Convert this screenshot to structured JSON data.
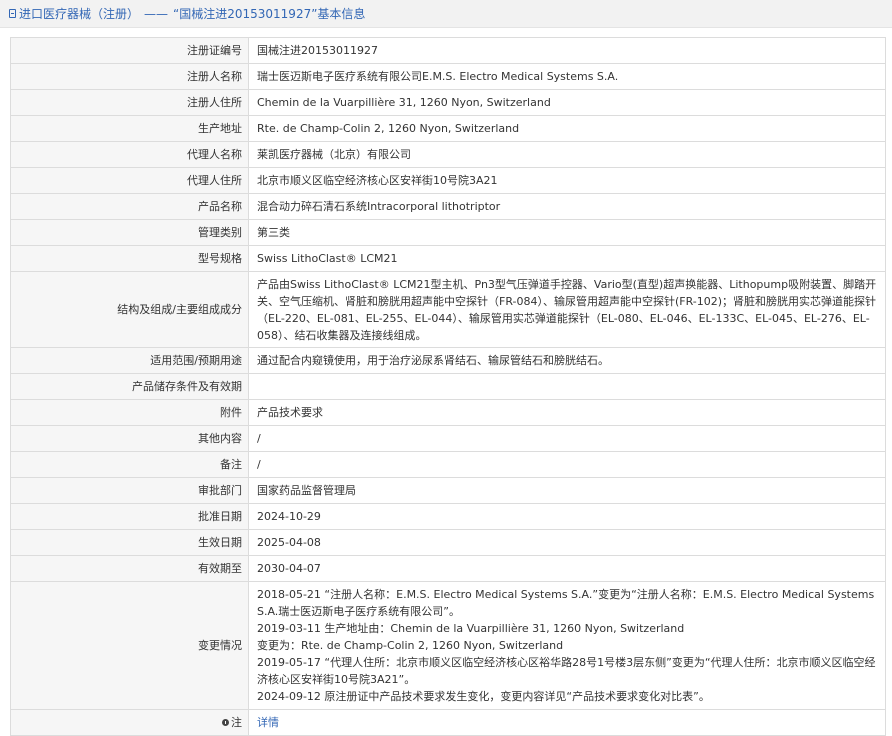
{
  "header": {
    "section": "进口医疗器械（注册）",
    "separator": "——",
    "record_title": "“国械注进20153011927”基本信息"
  },
  "rows": [
    {
      "label": "注册证编号",
      "value": "国械注进20153011927"
    },
    {
      "label": "注册人名称",
      "value": "瑞士医迈斯电子医疗系统有限公司E.M.S. Electro Medical Systems S.A."
    },
    {
      "label": "注册人住所",
      "value": "Chemin de la Vuarpillière 31, 1260 Nyon, Switzerland"
    },
    {
      "label": "生产地址",
      "value": "Rte. de Champ-Colin 2, 1260 Nyon, Switzerland"
    },
    {
      "label": "代理人名称",
      "value": "莱凯医疗器械（北京）有限公司"
    },
    {
      "label": "代理人住所",
      "value": "北京市顺义区临空经济核心区安祥街10号院3A21"
    },
    {
      "label": "产品名称",
      "value": "混合动力碎石清石系统Intracorporal lithotriptor"
    },
    {
      "label": "管理类别",
      "value": "第三类"
    },
    {
      "label": "型号规格",
      "value": "Swiss LithoClast® LCM21"
    },
    {
      "label": "结构及组成/主要组成成分",
      "value": "产品由Swiss LithoClast® LCM21型主机、Pn3型气压弹道手控器、Vario型(直型)超声换能器、Lithopump吸附装置、脚踏开关、空气压缩机、肾脏和膀胱用超声能中空探针（FR-084）、输尿管用超声能中空探针(FR-102)；肾脏和膀胱用实芯弹道能探针（EL-220、EL-081、EL-255、EL-044）、输尿管用实芯弹道能探针（EL-080、EL-046、EL-133C、EL-045、EL-276、EL-058）、结石收集器及连接线组成。"
    },
    {
      "label": "适用范围/预期用途",
      "value": "通过配合内窥镜使用，用于治疗泌尿系肾结石、输尿管结石和膀胱结石。"
    },
    {
      "label": "产品储存条件及有效期",
      "value": ""
    },
    {
      "label": "附件",
      "value": "产品技术要求"
    },
    {
      "label": "其他内容",
      "value": "/"
    },
    {
      "label": "备注",
      "value": "/"
    },
    {
      "label": "审批部门",
      "value": "国家药品监督管理局"
    },
    {
      "label": "批准日期",
      "value": "2024-10-29"
    },
    {
      "label": "生效日期",
      "value": "2025-04-08"
    },
    {
      "label": "有效期至",
      "value": "2030-04-07"
    }
  ],
  "changes": {
    "label": "变更情况",
    "lines": [
      "2018-05-21 “注册人名称：E.M.S. Electro Medical Systems S.A.”变更为“注册人名称：E.M.S. Electro Medical Systems S.A.瑞士医迈斯电子医疗系统有限公司”。",
      "2019-03-11 生产地址由：Chemin de la Vuarpillière 31, 1260 Nyon, Switzerland",
      "变更为：Rte. de Champ-Colin 2, 1260 Nyon, Switzerland",
      "2019-05-17 “代理人住所：北京市顺义区临空经济核心区裕华路28号1号楼3层东侧”变更为“代理人住所：北京市顺义区临空经济核心区安祥街10号院3A21”。",
      "2024-09-12 原注册证中产品技术要求发生变化，变更内容详见“产品技术要求变化对比表”。"
    ]
  },
  "note": {
    "label": "注",
    "icon": "info-dot-icon",
    "link_text": "详情"
  },
  "colors": {
    "link": "#3367b5",
    "label_bg": "#f6f6f6",
    "border": "#dcdcdc",
    "header_bg": "#f2f2f2"
  }
}
